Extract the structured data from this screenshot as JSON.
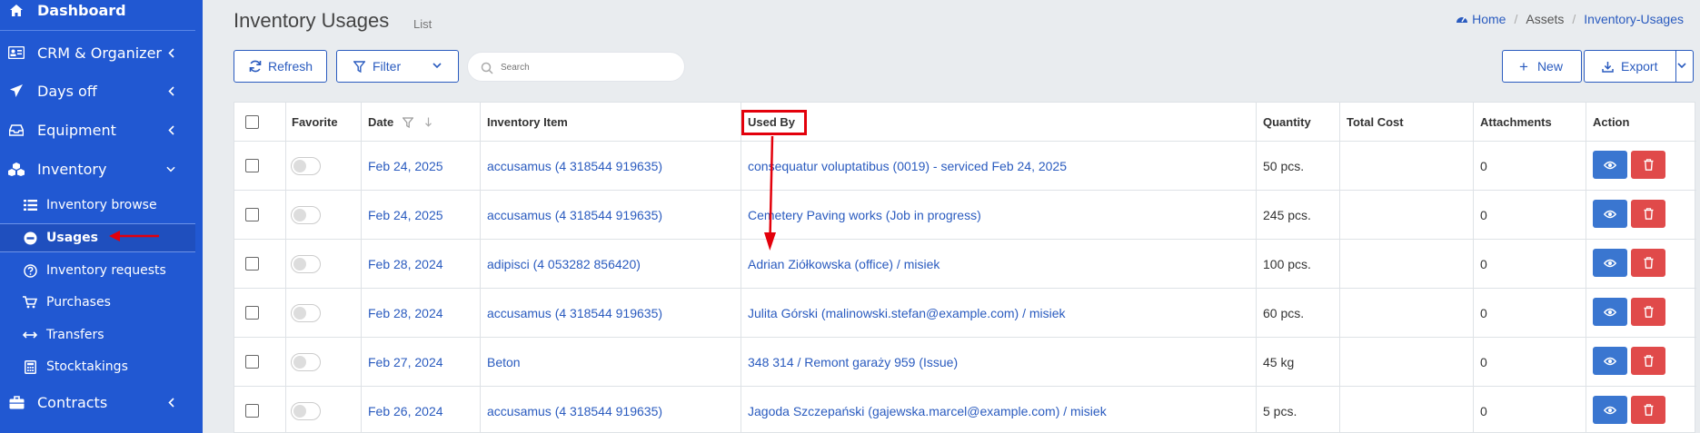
{
  "sidebar": {
    "items": [
      {
        "label": "Dashboard",
        "icon": "home-icon"
      },
      {
        "label": "CRM & Organizer",
        "icon": "id-card-icon"
      },
      {
        "label": "Days off",
        "icon": "plane-icon"
      },
      {
        "label": "Equipment",
        "icon": "tray-icon"
      },
      {
        "label": "Inventory",
        "icon": "cubes-icon"
      },
      {
        "label": "Contracts",
        "icon": "briefcase-icon"
      }
    ],
    "subitems": [
      {
        "label": "Inventory browse",
        "icon": "list-icon"
      },
      {
        "label": "Usages",
        "icon": "minus-circle-icon"
      },
      {
        "label": "Inventory requests",
        "icon": "question-circle-icon"
      },
      {
        "label": "Purchases",
        "icon": "cart-icon"
      },
      {
        "label": "Transfers",
        "icon": "arrows-h-icon"
      },
      {
        "label": "Stocktakings",
        "icon": "calculator-icon"
      }
    ]
  },
  "header": {
    "title": "Inventory Usages",
    "subtitle": "List",
    "breadcrumb": [
      "Home",
      "Assets",
      "Inventory-Usages"
    ]
  },
  "toolbar": {
    "refresh_label": "Refresh",
    "filter_label": "Filter",
    "search_placeholder": "Search",
    "new_label": "New",
    "export_label": "Export"
  },
  "table": {
    "columns": [
      "Favorite",
      "Date",
      "Inventory Item",
      "Used By",
      "Quantity",
      "Total Cost",
      "Attachments",
      "Action"
    ],
    "rows": [
      {
        "date": "Feb 24, 2025",
        "item": "accusamus (4 318544 919635)",
        "used_by": "consequatur voluptatibus (0019) - serviced Feb 24, 2025",
        "quantity": "50 pcs.",
        "total_cost": "",
        "attachments": "0"
      },
      {
        "date": "Feb 24, 2025",
        "item": "accusamus (4 318544 919635)",
        "used_by": "Cemetery Paving works (Job in progress)",
        "quantity": "245 pcs.",
        "total_cost": "",
        "attachments": "0"
      },
      {
        "date": "Feb 28, 2024",
        "item": "adipisci (4 053282 856420)",
        "used_by": "Adrian Ziółkowska (office) / misiek",
        "quantity": "100 pcs.",
        "total_cost": "",
        "attachments": "0"
      },
      {
        "date": "Feb 28, 2024",
        "item": "accusamus (4 318544 919635)",
        "used_by": "Julita Górski (malinowski.stefan@example.com) / misiek",
        "quantity": "60 pcs.",
        "total_cost": "",
        "attachments": "0"
      },
      {
        "date": "Feb 27, 2024",
        "item": "Beton",
        "used_by": "348 314 / Remont garaży 959 (Issue)",
        "quantity": "45 kg",
        "total_cost": "",
        "attachments": "0"
      },
      {
        "date": "Feb 26, 2024",
        "item": "accusamus (4 318544 919635)",
        "used_by": "Jagoda Szczepański (gajewska.marcel@example.com) / misiek",
        "quantity": "5 pcs.",
        "total_cost": "",
        "attachments": "0"
      }
    ]
  },
  "colors": {
    "sidebar": "#2158d2",
    "accent": "#2a5bbf",
    "view_button": "#3a76d0",
    "delete_button": "#e04a4a",
    "annotation": "#e3000b"
  }
}
